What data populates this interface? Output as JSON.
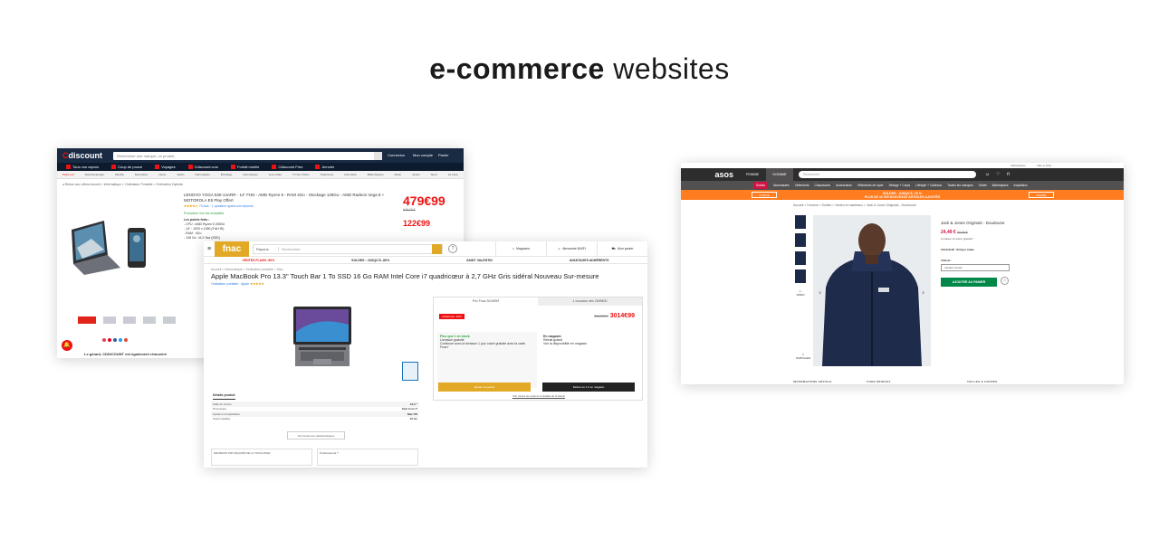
{
  "heading": {
    "bold": "e-commerce",
    "light": "websites"
  },
  "cdiscount": {
    "logo_c": "C",
    "logo": "discount",
    "search_placeholder": "Rechercher une marque, un produit...",
    "account": "Connexion",
    "account2": "Mon compte",
    "cart": "Panier",
    "nav": [
      "Tous nos rayons",
      "Coup de pouce",
      "Voyages",
      "Cdiscount.com",
      "Forfait mobile",
      "Cdiscount Free",
      "Annuler"
    ],
    "categories": [
      "Petits prix",
      "Electroménager",
      "Meuble",
      "Décoration",
      "Literie",
      "Jardin",
      "Informatique",
      "Bricolage",
      "Informatique",
      "Jeux vidéo",
      "TV Son Photo",
      "Téléphonie",
      "Auto Moto",
      "Bébé Rayons",
      "Mode",
      "Jouets",
      "Sport",
      "La Cave"
    ],
    "breadcrumb": "◂ Retour aux offres   Accueil > Informatique > Ordinateur Portable > Ordinateur Hybride",
    "product_title": "LENOVO YOGA 530-14ARR - 14\" FHD - AMD Ryzen 5 - RAM 4Go - Stockage 128Go - AMD Radeon Vega 8 + MOTOROLA E5 Play Offert",
    "rating_stars": "★★★★☆",
    "rating_text": "73 avis · 1 question ayant une réponse",
    "promo": "Promotion  Voir les modalités",
    "points_title": "Les points forts :",
    "bullets": [
      "- CPU : AMD Ryzen 5 2500U",
      "- 14\" : 1920 x 1080 (Full HD)",
      "- RAM : 4Go",
      "- 128 Go : M.2 Ssd (SSD)"
    ],
    "price_main": "479€99",
    "price_old": "649,00 €",
    "price_sec": "122€99",
    "thumb_brand": "Lenovo",
    "alert_icon": "🔔",
    "footer_text": "Le gérant, CDISCOUNT est également rémunéré"
  },
  "fnac": {
    "logo": "fnac",
    "search_scope": "Rayons",
    "search_placeholder": "Rechercher",
    "links": [
      "Magasins",
      "Alexandre BARY",
      "Mon panier"
    ],
    "strip": [
      "VENTES FLASH -90%",
      "SOLDES : JUSQU'À -80%",
      "SAINT VALENTIN",
      "AVANTAGES ADHÉRENTS"
    ],
    "breadcrumb": "Accueil > Informatique > Ordinateur portable > Mac",
    "product_title": "Apple MacBook Pro 13.3\" Touch Bar 1 To SSD 16 Go RAM Intel Core i7 quadricœur à 2,7 GHz Gris sidéral Nouveau Sur-mesure",
    "sub": "Ordinateur portable · Apple",
    "stars": "★★★★★",
    "tab_label": "Détails produit",
    "specs": [
      {
        "k": "Taille de l'écran",
        "v": "13,3 \""
      },
      {
        "k": "Processeur",
        "v": "Intel Core i7"
      },
      {
        "k": "Système d'exploitation",
        "v": "Mac OS"
      },
      {
        "k": "Stock installée",
        "v": "16 Go"
      }
    ],
    "more_btn": "Voir toutes les caractéristiques",
    "box1": "MACBOOK PRO ÉQUIPÉ DE LA TOUCH BAR",
    "box2": "Professionnel ?",
    "buy_tabs": [
      "Prix Fnac 3014€99",
      "1 occasion dès 2695€00"
    ],
    "badge": "Adhérents -10%",
    "price_old": "3349€99",
    "price": "3014€99",
    "col_left": [
      "Plus que 1 en stock",
      "Livraison gratuite",
      "Continuer avec la livraison 1 jour ouvré gratuite avec la carte Fnac+"
    ],
    "col_right": [
      "En magasin",
      "Retrait gratuit",
      "Voir la disponibilité en magasin"
    ],
    "add_cart": "Ajouter au panier",
    "store_btn": "Retirer en 1 h en magasin",
    "all_offers": "Voir toutes les options et détails de livraison"
  },
  "asos": {
    "util": [
      "Marketplace",
      "Aide et FAQ"
    ],
    "logo": "asos",
    "genders": [
      "FEMME",
      "HOMME"
    ],
    "search_placeholder": "Rechercher",
    "categories": [
      "Soldes",
      "Nouveautés",
      "Vêtements",
      "Chaussures",
      "Accessoires",
      "Vêtements de sport",
      "Vintage + Corps",
      "Lifestyle + Cadeaux",
      "Toutes les marques",
      "Outlet",
      "Marketplace",
      "Inspiration"
    ],
    "promo_left": "HOMME",
    "promo_mid_1": "SOLDES : JUSQU'À -70 %",
    "promo_mid_2": "PLUS DE 10 000 NOUVEAUX ARTICLES AJOUTÉS",
    "promo_right": "FEMME",
    "breadcrumb": "Accueil > Homme > Soldes > Vestes et manteaux > Jack & Jones Originals - Doudoune",
    "video": "VIDÉO",
    "share": "PARTAGER",
    "product_name": "Jack & Jones Originals - Doudoune",
    "price": "24,49 €",
    "price_old": "69,99 €",
    "installments": "Livraison et retour gratuits*",
    "color_label": "COULEUR : Éclipse totale",
    "size_label": "TAILLE :",
    "size_value": "Veuillez choisir",
    "add_btn": "AJOUTER AU PANIER",
    "footer": [
      "INFORMATIONS ARTICLE",
      "CODE PRODUIT",
      "TAILLES & COUPES"
    ]
  }
}
